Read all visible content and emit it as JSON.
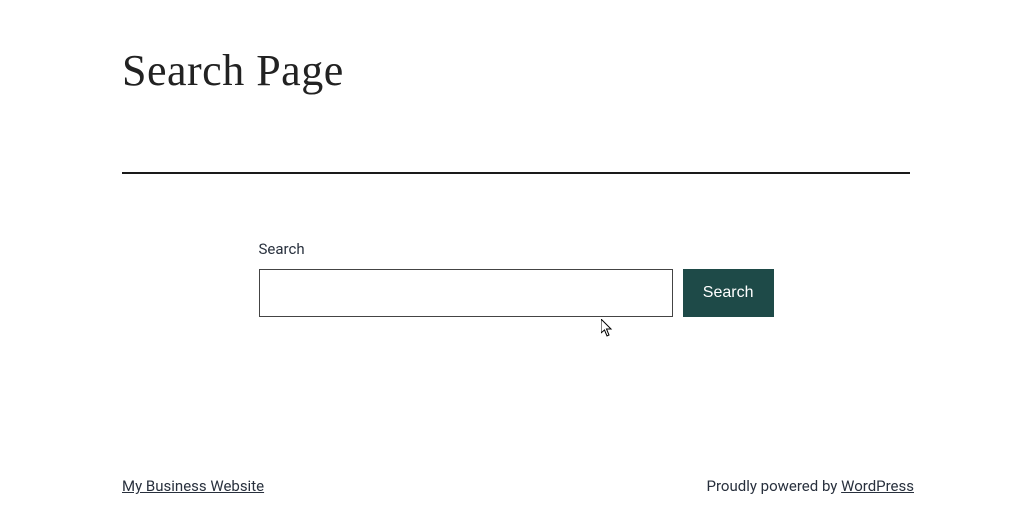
{
  "header": {
    "title": "Search Page"
  },
  "search": {
    "label": "Search",
    "button_label": "Search",
    "input_value": ""
  },
  "footer": {
    "site_link": "My Business Website",
    "powered_prefix": "Proudly powered by ",
    "powered_link": "WordPress"
  },
  "colors": {
    "button_bg": "#1e4a48"
  }
}
